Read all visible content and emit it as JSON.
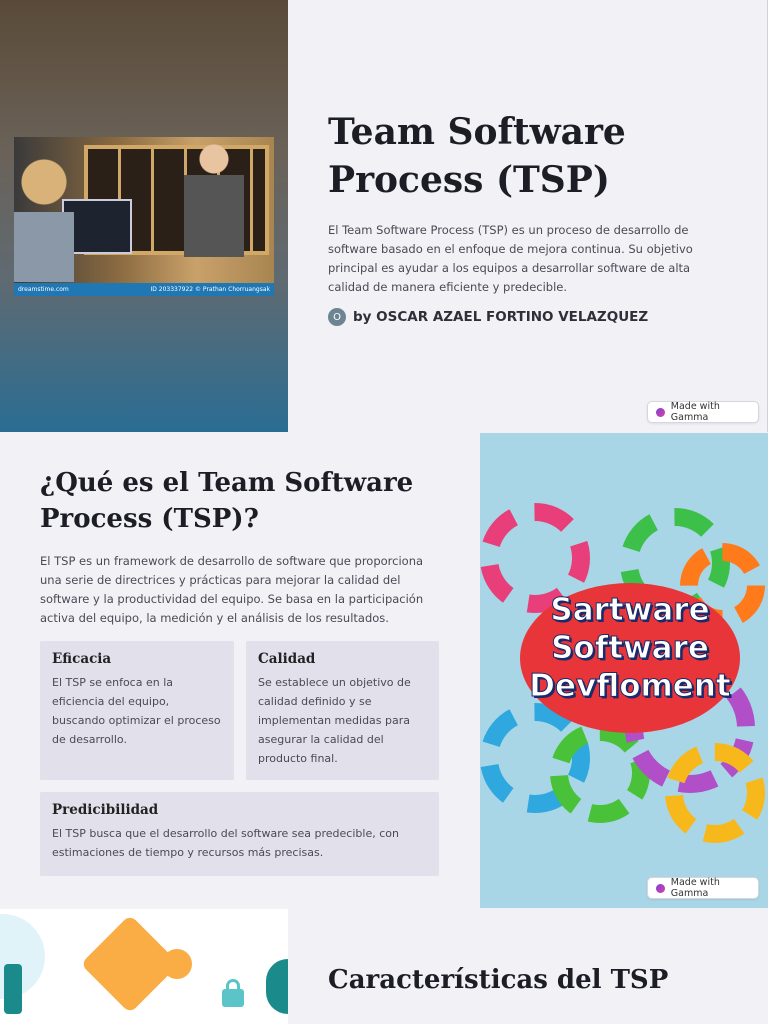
{
  "slide1": {
    "title": "Team Software Process (TSP)",
    "description": "El Team Software Process (TSP) es un proceso de desarrollo de software basado en el enfoque de mejora continua. Su objetivo principal es ayudar a los equipos a desarrollar software de alta calidad de manera eficiente y predecible.",
    "author_initial": "O",
    "author": "by OSCAR AZAEL FORTINO VELAZQUEZ",
    "photo_watermark": "dreamstime.com",
    "photo_id": "ID 203337922 © Prathan Chorruangsak"
  },
  "gamma_badge": "Made with Gamma",
  "slide2": {
    "title": "¿Qué es el Team Software Process (TSP)?",
    "description": "El TSP es un framework de desarrollo de software que proporciona una serie de directrices y prácticas para mejorar la calidad del software y la productividad del equipo. Se basa en la participación activa del equipo, la medición y el análisis de los resultados.",
    "cards": [
      {
        "title": "Eficacia",
        "text": "El TSP se enfoca en la eficiencia del equipo, buscando optimizar el proceso de desarrollo."
      },
      {
        "title": "Calidad",
        "text": "Se establece un objetivo de calidad definido y se implementan medidas para asegurar la calidad del producto final."
      },
      {
        "title": "Predicibilidad",
        "text": "El TSP busca que el desarrollo del software sea predecible, con estimaciones de tiempo y recursos más precisas."
      }
    ],
    "image_text": "Sartware Software Devfloment"
  },
  "slide3": {
    "title": "Características del TSP"
  },
  "colors": {
    "background": "#f2f1f6",
    "card": "#e1e0eb",
    "accent": "#7b3fe4"
  }
}
